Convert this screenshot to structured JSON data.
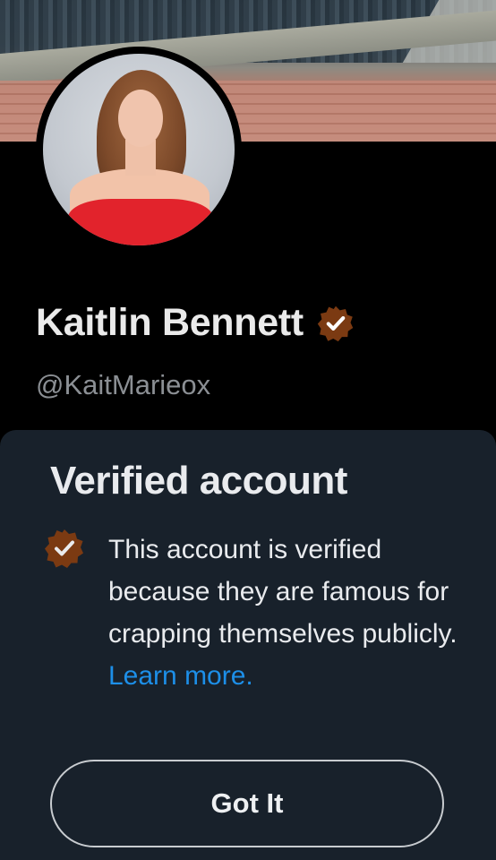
{
  "profile": {
    "name": "Kaitlin Bennett",
    "handle": "@KaitMarieox",
    "badge_color": "#7b3a12"
  },
  "verified_sheet": {
    "title": "Verified account",
    "description": "This account is verified because they are famous for crapping themselves publicly.",
    "learn_more": "Learn more.",
    "button_label": "Got It",
    "link_color": "#1d8fe8",
    "background": "#18212b"
  }
}
